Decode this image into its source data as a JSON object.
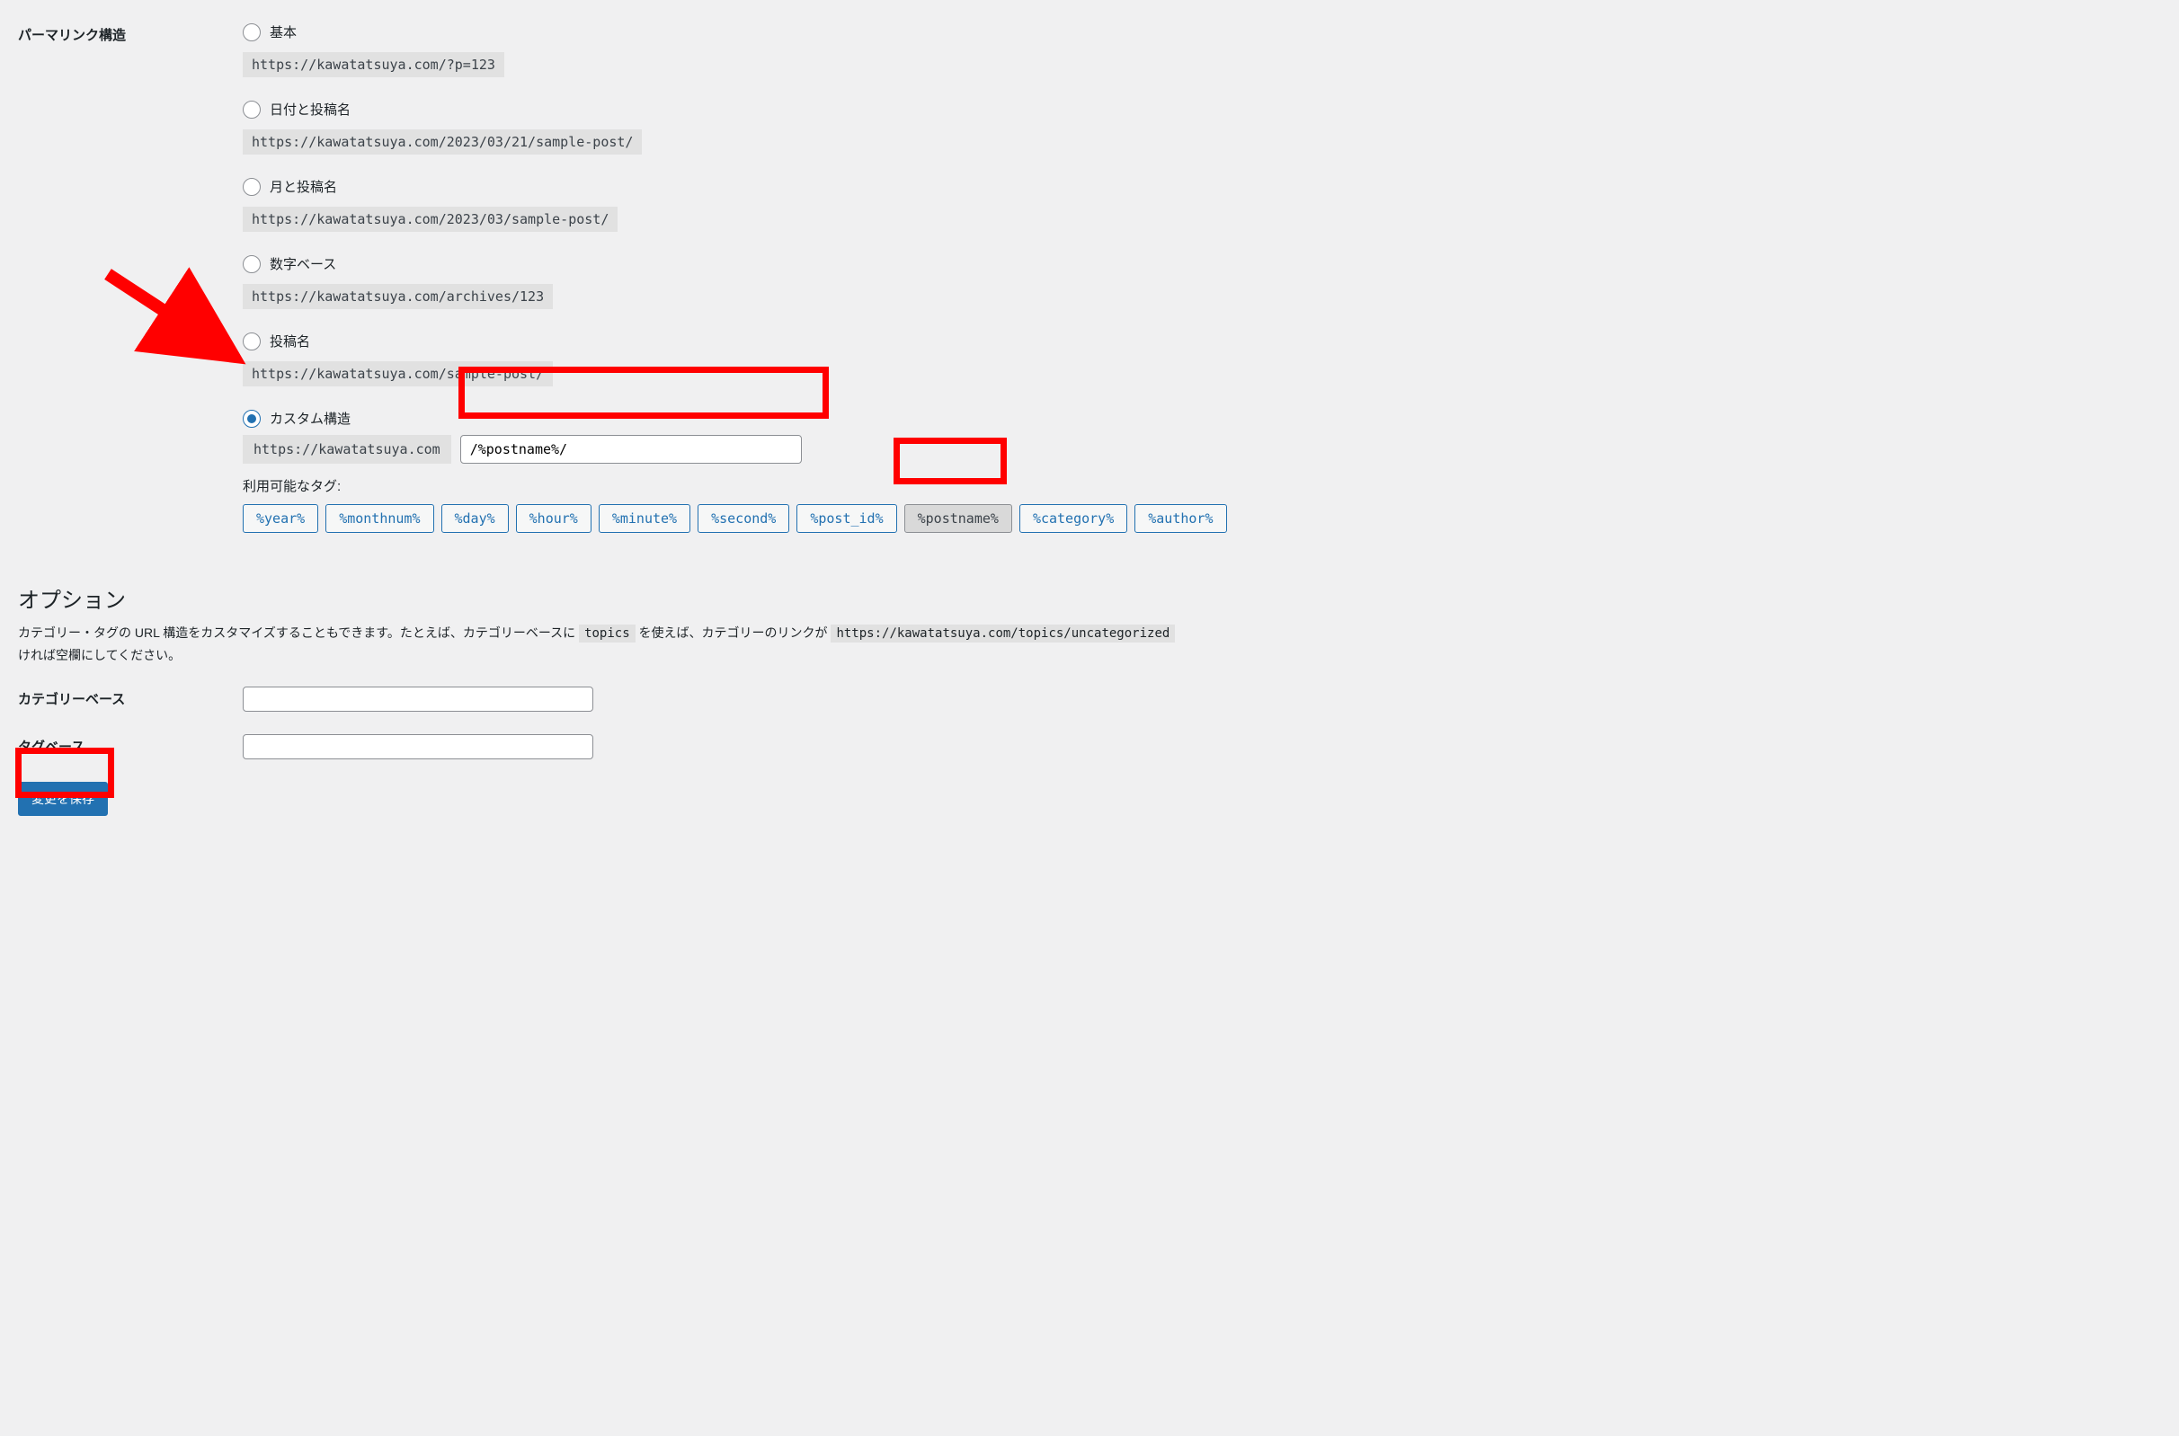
{
  "permalink": {
    "section_label": "パーマリンク構造",
    "options": [
      {
        "label": "基本",
        "example": "https://kawatatsuya.com/?p=123",
        "checked": false
      },
      {
        "label": "日付と投稿名",
        "example": "https://kawatatsuya.com/2023/03/21/sample-post/",
        "checked": false
      },
      {
        "label": "月と投稿名",
        "example": "https://kawatatsuya.com/2023/03/sample-post/",
        "checked": false
      },
      {
        "label": "数字ベース",
        "example": "https://kawatatsuya.com/archives/123",
        "checked": false
      },
      {
        "label": "投稿名",
        "example": "https://kawatatsuya.com/sample-post/",
        "checked": false
      },
      {
        "label": "カスタム構造",
        "checked": true
      }
    ],
    "custom_base": "https://kawatatsuya.com",
    "custom_value": "/%postname%/",
    "available_tags_label": "利用可能なタグ:",
    "tags": [
      {
        "text": "%year%",
        "active": false
      },
      {
        "text": "%monthnum%",
        "active": false
      },
      {
        "text": "%day%",
        "active": false
      },
      {
        "text": "%hour%",
        "active": false
      },
      {
        "text": "%minute%",
        "active": false
      },
      {
        "text": "%second%",
        "active": false
      },
      {
        "text": "%post_id%",
        "active": false
      },
      {
        "text": "%postname%",
        "active": true
      },
      {
        "text": "%category%",
        "active": false
      },
      {
        "text": "%author%",
        "active": false
      }
    ]
  },
  "optional": {
    "heading": "オプション",
    "desc_pre": "カテゴリー・タグの URL 構造をカスタマイズすることもできます。たとえば、カテゴリーベースに ",
    "desc_code1": "topics",
    "desc_mid": " を使えば、カテゴリーのリンクが ",
    "desc_code2": "https://kawatatsuya.com/topics/uncategorized",
    "desc_post": "ければ空欄にしてください。",
    "cat_base_label": "カテゴリーベース",
    "tag_base_label": "タグベース",
    "cat_value": "",
    "tag_value": ""
  },
  "save_label": "変更を保存"
}
